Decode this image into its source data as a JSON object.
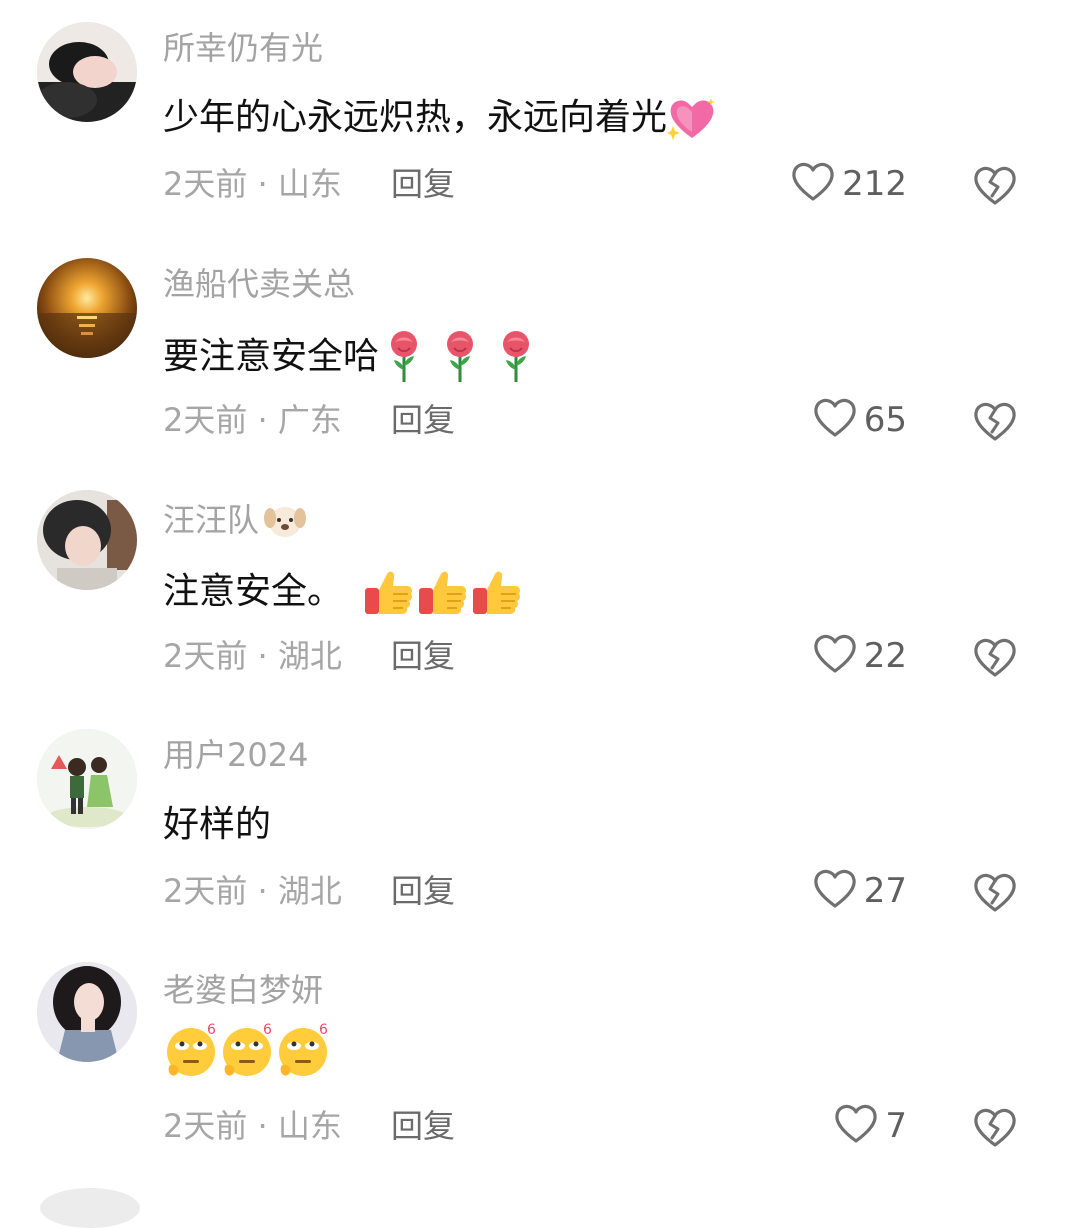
{
  "comments": [
    {
      "username": "所幸仍有光",
      "text": "少年的心永远炽热，永远向着光",
      "text_emoji": "sparkling-heart",
      "time": "2天前",
      "location": "山东",
      "meta": "2天前 · 山东",
      "reply_label": "回复",
      "likes": "212"
    },
    {
      "username": "渔船代卖关总",
      "text": "要注意安全哈",
      "text_emoji": "rose",
      "time": "2天前",
      "location": "广东",
      "meta": "2天前 · 广东",
      "reply_label": "回复",
      "likes": "65"
    },
    {
      "username": "汪汪队",
      "name_emoji": "dog-face",
      "text": "注意安全。",
      "text_emoji": "thumbs-up",
      "time": "2天前",
      "location": "湖北",
      "meta": "2天前 · 湖北",
      "reply_label": "回复",
      "likes": "22"
    },
    {
      "username": "用户2024",
      "text": "好样的",
      "time": "2天前",
      "location": "湖北",
      "meta": "2天前 · 湖北",
      "reply_label": "回复",
      "likes": "27"
    },
    {
      "username": "老婆白梦妍",
      "text": "",
      "text_emoji": "eye-roll-six",
      "time": "2天前",
      "location": "山东",
      "meta": "2天前 · 山东",
      "reply_label": "回复",
      "likes": "7"
    }
  ],
  "icons": {
    "like": "heart-outline-icon",
    "dislike": "broken-heart-icon"
  },
  "colors": {
    "username": "#a3a3a3",
    "meta": "#a6a6a6",
    "reply": "#6b6b6b",
    "like_count": "#5f5f5f",
    "icon_stroke": "#707070"
  }
}
